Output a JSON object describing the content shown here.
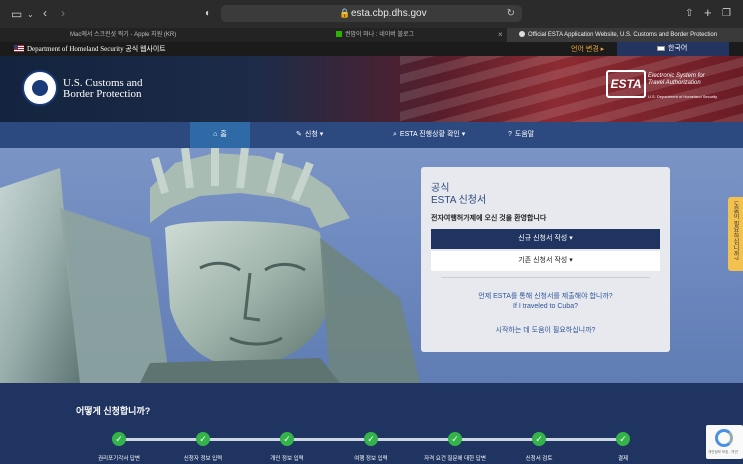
{
  "browser": {
    "url": "esta.cbp.dhs.gov",
    "tabs": [
      {
        "label": "Mac에서 스크린샷 찍기 - Apple 지원 (KR)",
        "active": false
      },
      {
        "label": "권맘이 마나 : 네이버 블로그",
        "active": false
      },
      {
        "label": "Official ESTA Application Website, U.S. Customs and Border Protection",
        "active": true
      }
    ],
    "tab_close": "×"
  },
  "gov_banner": {
    "text": "Department of Homeland Security 공식 웹사이트",
    "language_change": "언어 변경",
    "language_selected": "한국어"
  },
  "header": {
    "agency_line1": "U.S. Customs and",
    "agency_line2": "Border Protection",
    "esta_logo": "ESTA",
    "esta_sub1": "Electronic System for",
    "esta_sub2": "Travel Authorization",
    "esta_dept": "U.S. Department of Homeland Security"
  },
  "nav": {
    "home": "홈",
    "apply": "신청",
    "check_status": "ESTA 진행상황 확인",
    "help": "도움말"
  },
  "card": {
    "title1": "공식",
    "title2": "ESTA 신청서",
    "welcome": "전자여행허가제에 오신 것을 환영합니다",
    "new_application": "신규 신청서 작성 ▾",
    "existing_application": "기존 신청서 작성 ▾",
    "link_when": "언제 ESTA를 통해 신청서를 제출해야 합니까?",
    "link_cuba": "If I traveled to Cuba?",
    "link_help": "시작하는 데 도움이 필요하십니까?"
  },
  "side_tab": "도움이 필요하십니까?",
  "steps": {
    "title": "어떻게 신청합니까?",
    "items": [
      "권리포기각서 답변",
      "신청자 정보 입력",
      "개인 정보 입력",
      "여행 정보 입력",
      "자격 요건 질문에 대한 답변",
      "신청서 검토",
      "결제"
    ]
  },
  "recaptcha": {
    "text": "개인정보 보호 - 약관"
  },
  "colors": {
    "nav_bg": "#2d4a80",
    "primary_button": "#1f3461",
    "step_done": "#33b34a",
    "language_accent": "#f2a63a"
  }
}
